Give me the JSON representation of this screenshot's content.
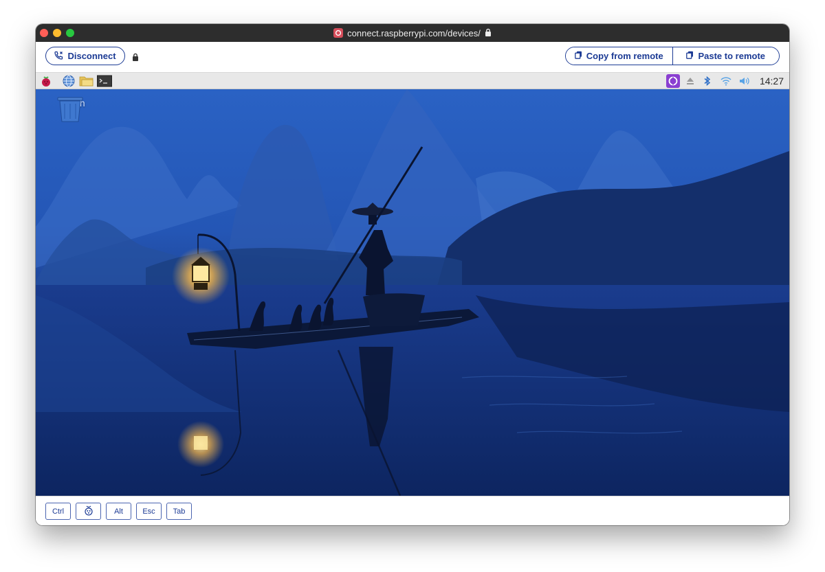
{
  "browser": {
    "url": "connect.raspberrypi.com/devices/"
  },
  "toolbar": {
    "disconnect_label": "Disconnect",
    "copy_label": "Copy from remote",
    "paste_label": "Paste to remote"
  },
  "remote_taskbar": {
    "launcher_icons": [
      "raspberry-menu-icon",
      "web-browser-icon",
      "file-manager-icon",
      "terminal-icon"
    ],
    "tray_icons": [
      "raspberry-connect-icon",
      "eject-icon",
      "bluetooth-icon",
      "wifi-icon",
      "volume-icon"
    ],
    "clock": "14:27"
  },
  "desktop": {
    "trash_label": "Trash"
  },
  "keys": {
    "ctrl": "Ctrl",
    "raspberry": "raspberry-key-icon",
    "alt": "Alt",
    "esc": "Esc",
    "tab": "Tab"
  },
  "colors": {
    "accent": "#1b3a94",
    "titlebar": "#2d2d2d",
    "taskbar": "#e8e8e8",
    "connect_icon": "#8a3fd1"
  }
}
